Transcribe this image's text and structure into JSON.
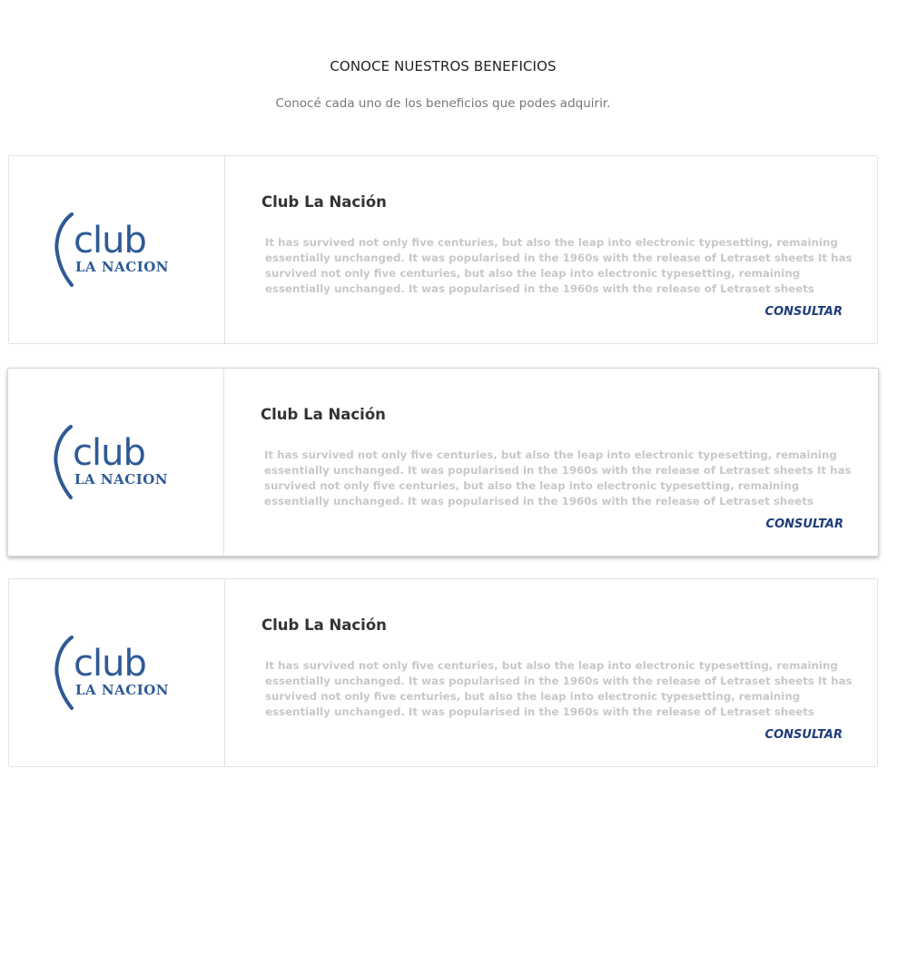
{
  "header": {
    "title": "CONOCE NUESTROS BENEFICIOS",
    "subtitle": "Conocé cada uno de los beneficios que podes adquirir."
  },
  "brand": {
    "logo_word_top": "club",
    "logo_word_bottom": "LA NACION",
    "logo_color": "#2e5a96",
    "action_color": "#1f3d7a"
  },
  "benefits": [
    {
      "title": "Club La Nación",
      "description": "It has survived not only five centuries, but also the leap into electronic typesetting, remaining essentially unchanged. It was popularised in the 1960s with the release of Letraset sheets It has survived not only five centuries, but also the leap into electronic typesetting, remaining essentially unchanged. It was popularised in the 1960s with the release of Letraset sheets",
      "action": "CONSULTAR",
      "logo_icon": "club-la-nacion-logo"
    },
    {
      "title": "Club La Nación",
      "description": "It has survived not only five centuries, but also the leap into electronic typesetting, remaining essentially unchanged. It was popularised in the 1960s with the release of Letraset sheets It has survived not only five centuries, but also the leap into electronic typesetting, remaining essentially unchanged. It was popularised in the 1960s with the release of Letraset sheets",
      "action": "CONSULTAR",
      "logo_icon": "club-la-nacion-logo"
    },
    {
      "title": "Club La Nación",
      "description": "It has survived not only five centuries, but also the leap into electronic typesetting, remaining essentially unchanged. It was popularised in the 1960s with the release of Letraset sheets It has survived not only five centuries, but also the leap into electronic typesetting, remaining essentially unchanged. It was popularised in the 1960s with the release of Letraset sheets",
      "action": "CONSULTAR",
      "logo_icon": "club-la-nacion-logo"
    }
  ]
}
